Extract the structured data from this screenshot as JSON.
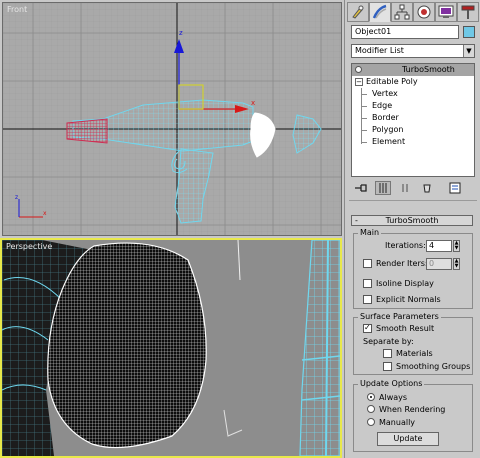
{
  "viewports": {
    "front": {
      "label": "Front"
    },
    "perspective": {
      "label": "Perspective"
    }
  },
  "command_panel": {
    "tabs": [
      "create-icon",
      "modify-icon",
      "hierarchy-icon",
      "motion-icon",
      "display-icon",
      "utilities-icon"
    ],
    "active_tab": "modify-icon",
    "object_name": "Object01",
    "object_color": "#6fc8e6",
    "modifier_list": "Modifier List",
    "stack": {
      "top_modifier": "TurboSmooth",
      "base_object": "Editable Poly",
      "sub_objects": [
        "Vertex",
        "Edge",
        "Border",
        "Polygon",
        "Element"
      ]
    },
    "stack_tools": [
      "pin-stack-icon",
      "show-end-result-icon",
      "make-unique-icon",
      "remove-modifier-icon",
      "configure-sets-icon"
    ]
  },
  "turbosmooth": {
    "rollout_title": "TurboSmooth",
    "rollout_toggle": "-",
    "main": {
      "title": "Main",
      "iterations_label": "Iterations:",
      "iterations_value": "4",
      "render_iters_label": "Render Iters:",
      "render_iters_value": "0",
      "render_iters_checked": false,
      "isoline_label": "Isoline Display",
      "isoline_checked": false,
      "explicit_normals_label": "Explicit Normals",
      "explicit_normals_checked": false
    },
    "surface": {
      "title": "Surface Parameters",
      "smooth_result_label": "Smooth Result",
      "smooth_result_checked": true,
      "separate_by_label": "Separate by:",
      "materials_label": "Materials",
      "materials_checked": false,
      "smoothing_groups_label": "Smoothing Groups",
      "smoothing_groups_checked": false
    },
    "update": {
      "title": "Update Options",
      "options": [
        "Always",
        "When Rendering",
        "Manually"
      ],
      "selected": "Always",
      "update_button": "Update"
    }
  },
  "colors": {
    "viewport_bg_front": "#a9a9a9",
    "viewport_bg_persp": "#8d8d8d",
    "active_viewport_border": "#e8e84a",
    "wire_cyan": "#6fd8ef",
    "wire_red": "#d02a50",
    "axis_x": "#d81818",
    "axis_y": "#1818d8",
    "axis_z": "#18a018"
  }
}
